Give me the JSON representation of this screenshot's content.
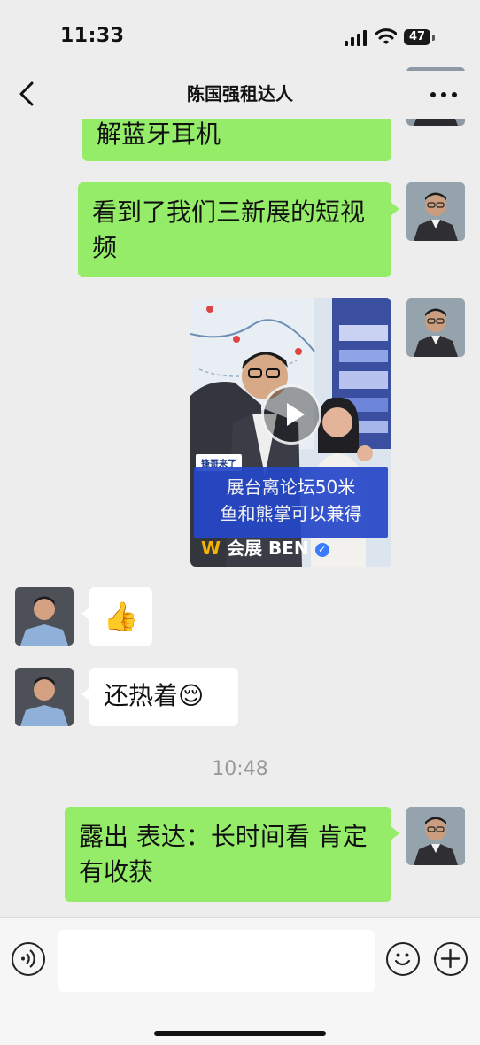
{
  "status_bar": {
    "time": "11:33",
    "battery": "47"
  },
  "header": {
    "title": "陈国强租达人"
  },
  "messages": [
    {
      "side": "right",
      "type": "text",
      "text": "解蓝牙耳机"
    },
    {
      "side": "right",
      "type": "text",
      "text": "看到了我们三新展的短视频"
    },
    {
      "side": "right",
      "type": "video",
      "tag": "锋哥来了",
      "caption_line1": "展台离论坛50米",
      "caption_line2": "鱼和熊掌可以兼得",
      "brand": "会展 BEN"
    },
    {
      "side": "left",
      "type": "emoji",
      "text": "👍"
    },
    {
      "side": "left",
      "type": "text",
      "text": "还热着😌"
    },
    {
      "type": "timestamp",
      "text": "10:48"
    },
    {
      "side": "right",
      "type": "text",
      "text": "露出 表达：长时间看 肯定有收获"
    }
  ],
  "input": {
    "placeholder": ""
  },
  "colors": {
    "bubble_self": "#95ec69",
    "bubble_other": "#ffffff",
    "background": "#ededed"
  }
}
